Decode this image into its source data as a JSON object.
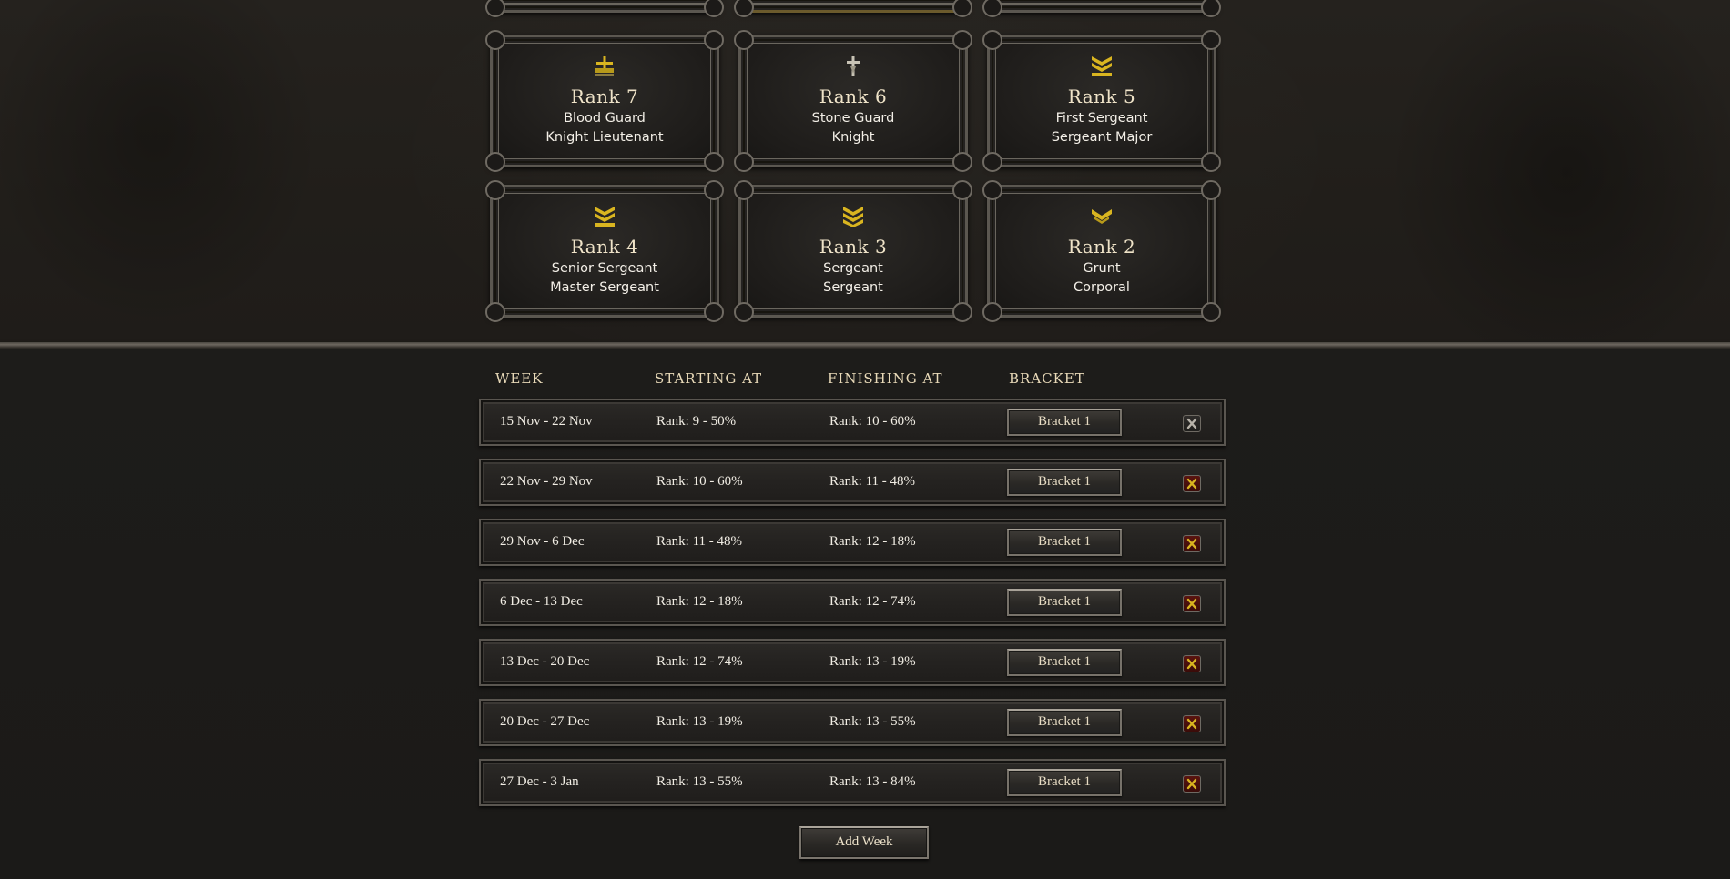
{
  "ranks": {
    "r7": {
      "title": "Rank 7",
      "line1": "Blood Guard",
      "line2": "Knight Lieutenant",
      "icon": "crossed-swords-insignia-icon"
    },
    "r6": {
      "title": "Rank 6",
      "line1": "Stone Guard",
      "line2": "Knight",
      "icon": "sword-insignia-icon"
    },
    "r5": {
      "title": "Rank 5",
      "line1": "First Sergeant",
      "line2": "Sergeant Major",
      "icon": "triple-chevron-insignia-icon"
    },
    "r4": {
      "title": "Rank 4",
      "line1": "Senior Sergeant",
      "line2": "Master Sergeant",
      "icon": "chevron-bar-insignia-icon"
    },
    "r3": {
      "title": "Rank 3",
      "line1": "Sergeant",
      "line2": "Sergeant",
      "icon": "double-chevron-insignia-icon"
    },
    "r2": {
      "title": "Rank 2",
      "line1": "Grunt",
      "line2": "Corporal",
      "icon": "single-chevron-insignia-icon"
    }
  },
  "table": {
    "headers": {
      "week": "WEEK",
      "start": "STARTING AT",
      "finish": "FINISHING AT",
      "bracket": "BRACKET"
    },
    "rows": [
      {
        "week": "15 Nov - 22 Nov",
        "start": "Rank: 9 - 50%",
        "finish": "Rank: 10 - 60%",
        "bracket": "Bracket 1",
        "remove_enabled": false
      },
      {
        "week": "22 Nov - 29 Nov",
        "start": "Rank: 10 - 60%",
        "finish": "Rank: 11 - 48%",
        "bracket": "Bracket 1",
        "remove_enabled": true
      },
      {
        "week": "29 Nov - 6 Dec",
        "start": "Rank: 11 - 48%",
        "finish": "Rank: 12 - 18%",
        "bracket": "Bracket 1",
        "remove_enabled": true
      },
      {
        "week": "6 Dec - 13 Dec",
        "start": "Rank: 12 - 18%",
        "finish": "Rank: 12 - 74%",
        "bracket": "Bracket 1",
        "remove_enabled": true
      },
      {
        "week": "13 Dec - 20 Dec",
        "start": "Rank: 12 - 74%",
        "finish": "Rank: 13 - 19%",
        "bracket": "Bracket 1",
        "remove_enabled": true
      },
      {
        "week": "20 Dec - 27 Dec",
        "start": "Rank: 13 - 19%",
        "finish": "Rank: 13 - 55%",
        "bracket": "Bracket 1",
        "remove_enabled": true
      },
      {
        "week": "27 Dec - 3 Jan",
        "start": "Rank: 13 - 55%",
        "finish": "Rank: 13 - 84%",
        "bracket": "Bracket 1",
        "remove_enabled": true
      }
    ]
  },
  "add_week_label": "Add Week",
  "colors": {
    "gold": "#d9b520",
    "remove_red": "#5a1410",
    "header_text": "#e8d9b8"
  }
}
